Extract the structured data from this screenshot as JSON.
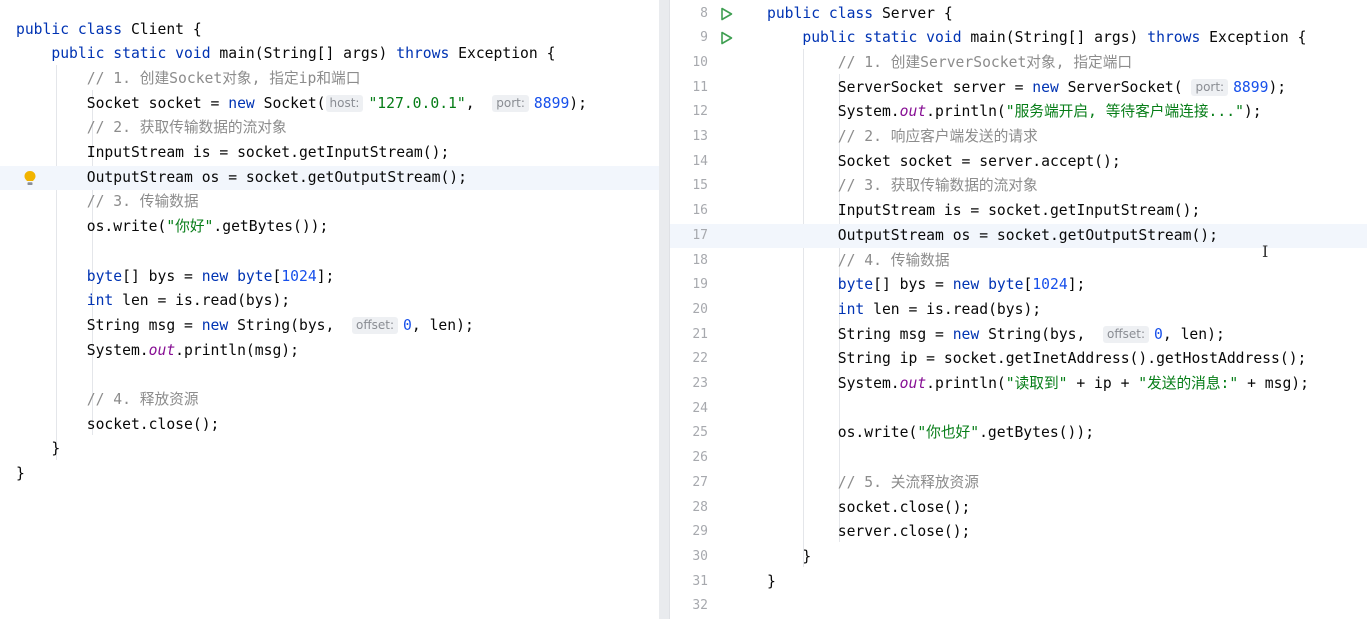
{
  "colors": {
    "keyword": "#0033b3",
    "string": "#067d17",
    "number": "#1750eb",
    "comment": "#8c8c8c",
    "static_field": "#871094",
    "run_gutter": "#3f9f52",
    "bulb": "#f2b400"
  },
  "client_editor": {
    "lines": [
      {
        "segments": [
          {
            "t": "public class ",
            "c": "kw"
          },
          {
            "t": "Client {"
          }
        ]
      },
      {
        "segments": [
          {
            "t": "    "
          },
          {
            "t": "public static void ",
            "c": "kw"
          },
          {
            "t": "main(String[] args) "
          },
          {
            "t": "throws ",
            "c": "kw"
          },
          {
            "t": "Exception {"
          }
        ]
      },
      {
        "segments": [
          {
            "t": "        "
          },
          {
            "t": "// 1. 创建Socket对象, 指定ip和端口",
            "c": "cmt"
          }
        ]
      },
      {
        "segments": [
          {
            "t": "        Socket socket = "
          },
          {
            "t": "new ",
            "c": "kw"
          },
          {
            "t": "Socket("
          },
          {
            "t": "host:",
            "c": "hint"
          },
          {
            "t": "\"127.0.0.1\"",
            "c": "str"
          },
          {
            "t": ",  "
          },
          {
            "t": "port:",
            "c": "hint"
          },
          {
            "t": "8899",
            "c": "num"
          },
          {
            "t": ");"
          }
        ]
      },
      {
        "segments": [
          {
            "t": "        "
          },
          {
            "t": "// 2. 获取传输数据的流对象",
            "c": "cmt"
          }
        ]
      },
      {
        "segments": [
          {
            "t": "        InputStream is = socket.getInputStream();"
          }
        ]
      },
      {
        "current": true,
        "bulb": true,
        "segments": [
          {
            "t": "        OutputStream os = socket.getOutputStream();"
          }
        ]
      },
      {
        "segments": [
          {
            "t": "        "
          },
          {
            "t": "// 3. 传输数据",
            "c": "cmt"
          }
        ]
      },
      {
        "segments": [
          {
            "t": "        os.write("
          },
          {
            "t": "\"你好\"",
            "c": "str"
          },
          {
            "t": ".getBytes());"
          }
        ]
      },
      {
        "segments": []
      },
      {
        "segments": [
          {
            "t": "        "
          },
          {
            "t": "byte",
            "c": "kw"
          },
          {
            "t": "[] bys = "
          },
          {
            "t": "new byte",
            "c": "kw"
          },
          {
            "t": "["
          },
          {
            "t": "1024",
            "c": "num"
          },
          {
            "t": "];"
          }
        ]
      },
      {
        "segments": [
          {
            "t": "        "
          },
          {
            "t": "int ",
            "c": "kw"
          },
          {
            "t": "len = is.read(bys);"
          }
        ]
      },
      {
        "segments": [
          {
            "t": "        String msg = "
          },
          {
            "t": "new ",
            "c": "kw"
          },
          {
            "t": "String(bys,  "
          },
          {
            "t": "offset:",
            "c": "hint"
          },
          {
            "t": "0",
            "c": "num"
          },
          {
            "t": ", len);"
          }
        ]
      },
      {
        "segments": [
          {
            "t": "        System."
          },
          {
            "t": "out",
            "c": "fld"
          },
          {
            "t": ".println(msg);"
          }
        ]
      },
      {
        "segments": []
      },
      {
        "segments": [
          {
            "t": "        "
          },
          {
            "t": "// 4. 释放资源",
            "c": "cmt"
          }
        ]
      },
      {
        "segments": [
          {
            "t": "        socket.close();"
          }
        ]
      },
      {
        "segments": [
          {
            "t": "    }"
          }
        ]
      },
      {
        "segments": [
          {
            "t": "}"
          }
        ]
      }
    ]
  },
  "server_editor": {
    "lines": [
      {
        "num": "8",
        "run": true,
        "segments": [
          {
            "t": "public class ",
            "c": "kw"
          },
          {
            "t": "Server {"
          }
        ]
      },
      {
        "num": "9",
        "run": true,
        "segments": [
          {
            "t": "    "
          },
          {
            "t": "public static void ",
            "c": "kw"
          },
          {
            "t": "main(String[] args) "
          },
          {
            "t": "throws ",
            "c": "kw"
          },
          {
            "t": "Exception {"
          }
        ]
      },
      {
        "num": "10",
        "segments": [
          {
            "t": "        "
          },
          {
            "t": "// 1. 创建ServerSocket对象, 指定端口",
            "c": "cmt"
          }
        ]
      },
      {
        "num": "11",
        "segments": [
          {
            "t": "        ServerSocket server = "
          },
          {
            "t": "new ",
            "c": "kw"
          },
          {
            "t": "ServerSocket( "
          },
          {
            "t": "port:",
            "c": "hint"
          },
          {
            "t": "8899",
            "c": "num"
          },
          {
            "t": ");"
          }
        ]
      },
      {
        "num": "12",
        "segments": [
          {
            "t": "        System."
          },
          {
            "t": "out",
            "c": "fld"
          },
          {
            "t": ".println("
          },
          {
            "t": "\"服务端开启, 等待客户端连接...\"",
            "c": "str"
          },
          {
            "t": ");"
          }
        ]
      },
      {
        "num": "13",
        "segments": [
          {
            "t": "        "
          },
          {
            "t": "// 2. 响应客户端发送的请求",
            "c": "cmt"
          }
        ]
      },
      {
        "num": "14",
        "segments": [
          {
            "t": "        Socket socket = server.accept();"
          }
        ]
      },
      {
        "num": "15",
        "segments": [
          {
            "t": "        "
          },
          {
            "t": "// 3. 获取传输数据的流对象",
            "c": "cmt"
          }
        ]
      },
      {
        "num": "16",
        "segments": [
          {
            "t": "        InputStream is = socket.getInputStream();"
          }
        ]
      },
      {
        "num": "17",
        "current": true,
        "segments": [
          {
            "t": "        OutputStream os = socket.getOutputStream();"
          }
        ]
      },
      {
        "num": "18",
        "segments": [
          {
            "t": "        "
          },
          {
            "t": "// 4. 传输数据",
            "c": "cmt"
          }
        ]
      },
      {
        "num": "19",
        "segments": [
          {
            "t": "        "
          },
          {
            "t": "byte",
            "c": "kw"
          },
          {
            "t": "[] bys = "
          },
          {
            "t": "new byte",
            "c": "kw"
          },
          {
            "t": "["
          },
          {
            "t": "1024",
            "c": "num"
          },
          {
            "t": "];"
          }
        ]
      },
      {
        "num": "20",
        "segments": [
          {
            "t": "        "
          },
          {
            "t": "int ",
            "c": "kw"
          },
          {
            "t": "len = is.read(bys);"
          }
        ]
      },
      {
        "num": "21",
        "segments": [
          {
            "t": "        String msg = "
          },
          {
            "t": "new ",
            "c": "kw"
          },
          {
            "t": "String(bys,  "
          },
          {
            "t": "offset:",
            "c": "hint"
          },
          {
            "t": "0",
            "c": "num"
          },
          {
            "t": ", len);"
          }
        ]
      },
      {
        "num": "22",
        "segments": [
          {
            "t": "        String ip = socket.getInetAddress().getHostAddress();"
          }
        ]
      },
      {
        "num": "23",
        "segments": [
          {
            "t": "        System."
          },
          {
            "t": "out",
            "c": "fld"
          },
          {
            "t": ".println("
          },
          {
            "t": "\"读取到\"",
            "c": "str"
          },
          {
            "t": " + ip + "
          },
          {
            "t": "\"发送的消息:\"",
            "c": "str"
          },
          {
            "t": " + msg);"
          }
        ]
      },
      {
        "num": "24",
        "segments": []
      },
      {
        "num": "25",
        "segments": [
          {
            "t": "        os.write("
          },
          {
            "t": "\"你也好\"",
            "c": "str"
          },
          {
            "t": ".getBytes());"
          }
        ]
      },
      {
        "num": "26",
        "segments": []
      },
      {
        "num": "27",
        "segments": [
          {
            "t": "        "
          },
          {
            "t": "// 5. 关流释放资源",
            "c": "cmt"
          }
        ]
      },
      {
        "num": "28",
        "segments": [
          {
            "t": "        socket.close();"
          }
        ]
      },
      {
        "num": "29",
        "segments": [
          {
            "t": "        server.close();"
          }
        ]
      },
      {
        "num": "30",
        "segments": [
          {
            "t": "    }"
          }
        ]
      },
      {
        "num": "31",
        "segments": [
          {
            "t": "}"
          }
        ]
      },
      {
        "num": "32",
        "segments": []
      }
    ]
  }
}
